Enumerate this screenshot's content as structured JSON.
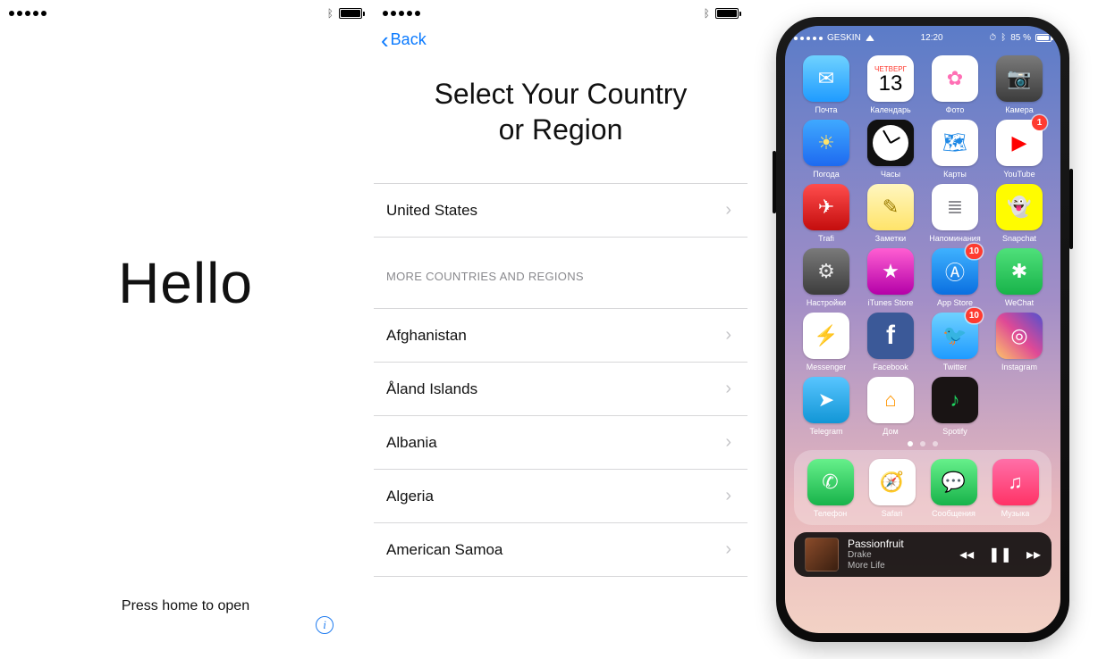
{
  "panel1": {
    "greeting": "Hello",
    "hint": "Press home to open"
  },
  "panel2": {
    "back_label": "Back",
    "title_line1": "Select Your Country",
    "title_line2": "or Region",
    "primary_country": "United States",
    "section_header": "MORE COUNTRIES AND REGIONS",
    "countries": [
      "Afghanistan",
      "Åland Islands",
      "Albania",
      "Algeria",
      "American Samoa"
    ]
  },
  "homescreen": {
    "status": {
      "carrier": "GESKIN",
      "time": "12:20",
      "battery_pct": "85 %"
    },
    "calendar": {
      "weekday": "ЧЕТВЕРГ",
      "day": "13"
    },
    "apps": [
      {
        "label": "Почта",
        "bg": "linear-gradient(#6fd2ff,#1f9bff)",
        "glyph": "✉",
        "fg": "#ffffff"
      },
      {
        "label": "Календарь",
        "bg": "#ffffff",
        "glyph": "",
        "fg": "#000000",
        "calendar": true
      },
      {
        "label": "Фото",
        "bg": "#ffffff",
        "glyph": "✿",
        "fg": "#ff6fb5"
      },
      {
        "label": "Камера",
        "bg": "linear-gradient(#7a7a7a,#3c3c3c)",
        "glyph": "📷",
        "fg": "#f0f0f0"
      },
      {
        "label": "Погода",
        "bg": "linear-gradient(#3fa9ff,#1e6af0)",
        "glyph": "☀",
        "fg": "#ffe36b"
      },
      {
        "label": "Часы",
        "bg": "#111111",
        "glyph": "",
        "fg": "#ffffff",
        "clock": true
      },
      {
        "label": "Карты",
        "bg": "#ffffff",
        "glyph": "🗺",
        "fg": "#1e88e5"
      },
      {
        "label": "YouTube",
        "bg": "#ffffff",
        "glyph": "▶",
        "fg": "#ff0000",
        "badge": "1"
      },
      {
        "label": "Trafi",
        "bg": "linear-gradient(#ff4d4d,#c40d0d)",
        "glyph": "✈",
        "fg": "#ffffff"
      },
      {
        "label": "Заметки",
        "bg": "linear-gradient(#fff6c0,#ffe46a)",
        "glyph": "✎",
        "fg": "#9b7b00"
      },
      {
        "label": "Напоминания",
        "bg": "#ffffff",
        "glyph": "≣",
        "fg": "#8e8e93"
      },
      {
        "label": "Snapchat",
        "bg": "#fffc00",
        "glyph": "👻",
        "fg": "#ffffff"
      },
      {
        "label": "Настройки",
        "bg": "linear-gradient(#7a7a7a,#3c3c3c)",
        "glyph": "⚙",
        "fg": "#e8e8e8"
      },
      {
        "label": "iTunes Store",
        "bg": "linear-gradient(#ff5fd2,#b400a8)",
        "glyph": "★",
        "fg": "#ffffff"
      },
      {
        "label": "App Store",
        "bg": "linear-gradient(#3fb2ff,#0a6fe0)",
        "glyph": "Ⓐ",
        "fg": "#ffffff",
        "badge": "10"
      },
      {
        "label": "WeChat",
        "bg": "linear-gradient(#4fe07a,#18b34a)",
        "glyph": "✱",
        "fg": "#ffffff"
      },
      {
        "label": "Messenger",
        "bg": "#ffffff",
        "glyph": "⚡",
        "fg": "#2b7bff"
      },
      {
        "label": "Facebook",
        "bg": "#3b5998",
        "glyph": "f",
        "fg": "#ffffff"
      },
      {
        "label": "Twitter",
        "bg": "linear-gradient(#6fd2ff,#1f9bff)",
        "glyph": "🐦",
        "fg": "#ffffff",
        "badge": "10"
      },
      {
        "label": "Instagram",
        "bg": "linear-gradient(45deg,#fdc468,#df4996,#5151cf)",
        "glyph": "◎",
        "fg": "#ffffff"
      },
      {
        "label": "Telegram",
        "bg": "linear-gradient(#58c5ff,#1296d6)",
        "glyph": "➤",
        "fg": "#ffffff"
      },
      {
        "label": "Дом",
        "bg": "#ffffff",
        "glyph": "⌂",
        "fg": "#ff9500"
      },
      {
        "label": "Spotify",
        "bg": "#191414",
        "glyph": "♪",
        "fg": "#1ed760"
      }
    ],
    "dock": [
      {
        "label": "Телефон",
        "bg": "linear-gradient(#66f08b,#18b34a)",
        "glyph": "✆",
        "fg": "#ffffff"
      },
      {
        "label": "Safari",
        "bg": "#ffffff",
        "glyph": "🧭",
        "fg": "#1f7cf0"
      },
      {
        "label": "Сообщения",
        "bg": "linear-gradient(#66f08b,#18b34a)",
        "glyph": "💬",
        "fg": "#ffffff"
      },
      {
        "label": "Музыка",
        "bg": "linear-gradient(#ff6fa8,#ff3366)",
        "glyph": "♫",
        "fg": "#ffffff"
      }
    ],
    "now_playing": {
      "title": "Passionfruit",
      "artist": "Drake",
      "album": "More Life"
    }
  }
}
